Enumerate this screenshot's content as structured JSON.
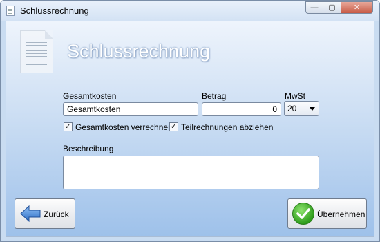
{
  "window": {
    "title": "Schlussrechnung",
    "controls": {
      "minimize": "—",
      "maximize": "▢",
      "close": "✕"
    }
  },
  "header": {
    "title": "Schlussrechnung",
    "icon": "document-icon"
  },
  "form": {
    "gesamtkosten": {
      "label": "Gesamtkosten",
      "value": "Gesamtkosten"
    },
    "betrag": {
      "label": "Betrag",
      "value": "0"
    },
    "mwst": {
      "label": "MwSt",
      "selected": "20"
    },
    "checkbox_verrechnen": {
      "label": "Gesamtkosten verrechnen",
      "checked": true,
      "mark": "✓"
    },
    "checkbox_teilrechnungen": {
      "label": "Teilrechnungen abziehen",
      "checked": true,
      "mark": "✓"
    },
    "beschreibung": {
      "label": "Beschreibung",
      "value": ""
    }
  },
  "buttons": {
    "back": {
      "label": "Zurück",
      "icon": "arrow-left-icon"
    },
    "apply": {
      "label": "Übernehmen",
      "icon": "checkmark-icon"
    }
  },
  "colors": {
    "accent": "#3a7fd0",
    "ok_green": "#2f9e1c"
  }
}
